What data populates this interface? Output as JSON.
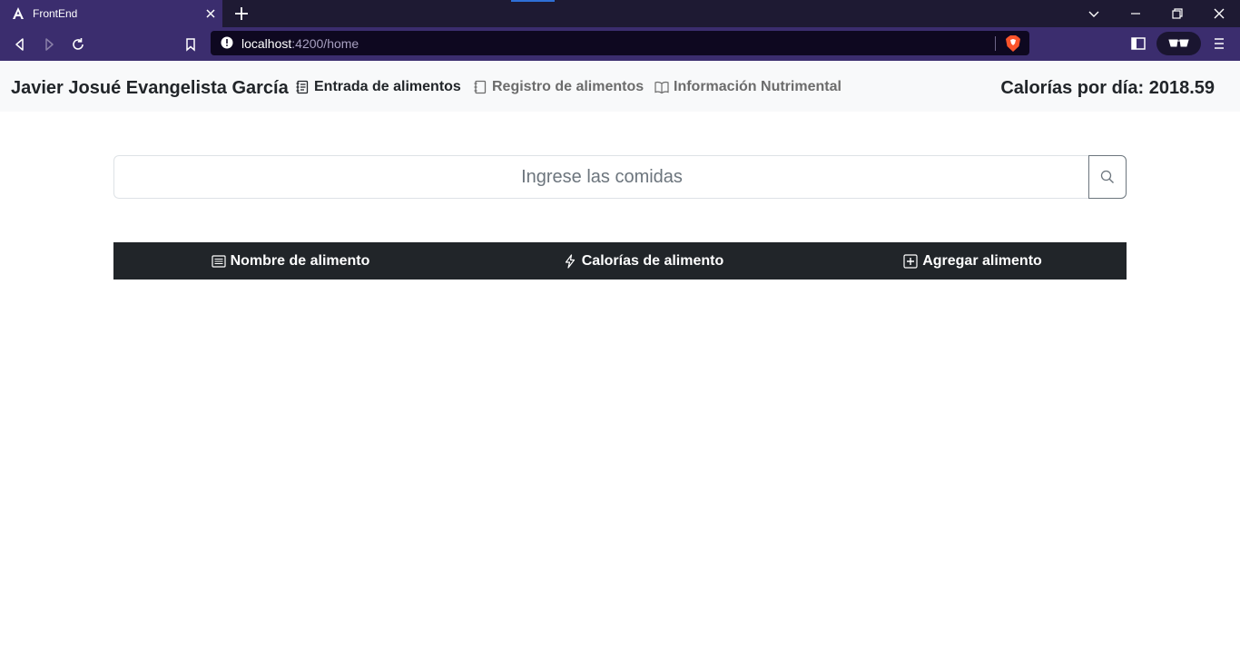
{
  "browser": {
    "tab_title": "FrontEnd",
    "url_host": "localhost",
    "url_path": ":4200/home"
  },
  "navbar": {
    "brand": "Javier Josué Evangelista García",
    "links": [
      {
        "label": "Entrada de alimentos",
        "icon": "journal-text-icon",
        "active": true
      },
      {
        "label": "Registro de alimentos",
        "icon": "journal-icon",
        "active": false
      },
      {
        "label": "Información Nutrimental",
        "icon": "book-icon",
        "active": false
      }
    ],
    "calories_label": "Calorías por día: 2018.59"
  },
  "search": {
    "placeholder": "Ingrese las comidas",
    "value": "",
    "button_icon": "search-icon"
  },
  "table": {
    "columns": [
      {
        "label": "Nombre de alimento",
        "icon": "list-icon"
      },
      {
        "label": "Calorías de alimento",
        "icon": "lightning-icon"
      },
      {
        "label": "Agregar alimento",
        "icon": "plus-square-icon"
      }
    ],
    "rows": []
  },
  "colors": {
    "browser_accent": "#3b2d6e",
    "navbar_bg": "#f8f9fa",
    "table_header_bg": "#212529"
  }
}
